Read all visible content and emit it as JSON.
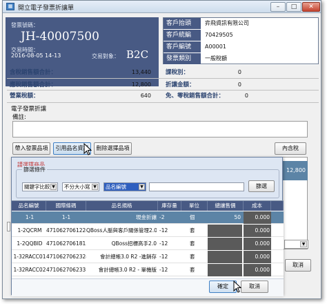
{
  "window": {
    "title": "開立電子發票折讓單",
    "icon": "app-icon"
  },
  "header": {
    "invoice_no_label": "發票號碼：",
    "invoice_no": "JH-40007500",
    "txn_time_label": "交易時間：",
    "txn_time": "2016-08-05 14-13",
    "txn_target_label": "交易對象：",
    "txn_target": "B2C"
  },
  "customer": [
    {
      "label": "客戶抬頭",
      "value": "弈飛資訊有限公司"
    },
    {
      "label": "客戶統編",
      "value": "70429505"
    },
    {
      "label": "客戶編號",
      "value": "A00001"
    },
    {
      "label": "發票類別",
      "value": "一般稅額"
    }
  ],
  "totals_left": [
    {
      "label": "含稅銷售額合計：",
      "value": "13,440"
    },
    {
      "label": "應稅銷售額合計：",
      "value": "12,800"
    },
    {
      "label": "營業稅額：",
      "value": "640"
    }
  ],
  "totals_right": [
    {
      "label": "課稅別：",
      "value": "0"
    },
    {
      "label": "折讓金額：",
      "value": "0"
    },
    {
      "label": "免、零稅銷售額合計：",
      "value": "0"
    }
  ],
  "allowance": {
    "group_label": "電子發票折讓",
    "note_label": "備註:",
    "btn_import": "帶入發票品項",
    "btn_reference": "引用品名資訊",
    "btn_delete": "刪除選擇品項",
    "btn_tax_incl": "內含稅",
    "behind_value": "12,800"
  },
  "picker": {
    "title": "請選擇商品",
    "filter_label": "篩選條件",
    "keyword_select": "關鍵字比較",
    "case_select": "不分大小寫",
    "field_select": "品名編號",
    "search_value": "",
    "filter_button": "篩選",
    "columns": [
      "品名編號",
      "國際條碼",
      "品名規格",
      "庫存量",
      "單位",
      "總讓售價",
      "成本"
    ],
    "rows": [
      {
        "code": "1-1",
        "barcode": "1-1",
        "name": "現金折讓",
        "stock": "-2",
        "unit": "個",
        "price": "50",
        "cost": "0.000"
      },
      {
        "code": "1-2QCRM",
        "barcode": "4710627061224",
        "name": "QBoss人脈與客戶關係管理2.0",
        "stock": "-12",
        "unit": "套",
        "price": "",
        "cost": "0.000"
      },
      {
        "code": "1-2QQBID",
        "barcode": "4710627061815",
        "name": "QBoss招標高手2.0",
        "stock": "-12",
        "unit": "套",
        "price": "",
        "cost": "0.000"
      },
      {
        "code": "1-32RACC01",
        "barcode": "4710627062324",
        "name": "會計總帳3.0 R2 -進銷存",
        "stock": "-12",
        "unit": "套",
        "price": "",
        "cost": "0.000"
      },
      {
        "code": "1-32RACC02",
        "barcode": "4710627062331",
        "name": "會計總帳3.0 R2 - 單機版",
        "stock": "-12",
        "unit": "套",
        "price": "",
        "cost": "0.000"
      }
    ],
    "ok_button": "確定",
    "cancel_button": "取消"
  },
  "main_cancel_button": "取消",
  "colors": {
    "header_blue": "#485a84",
    "selected_row": "#5c84a6",
    "note_red": "#c03030"
  }
}
